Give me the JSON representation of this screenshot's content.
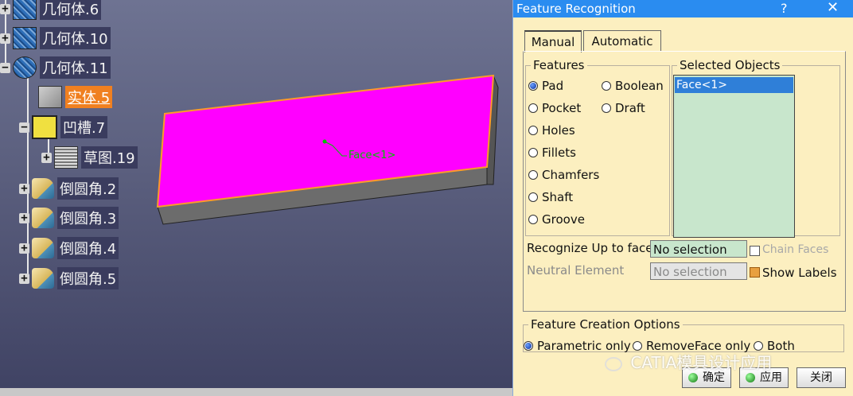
{
  "tree": {
    "nodes": [
      {
        "label": "几何体.6",
        "toggle": "+",
        "icon": "geometry-icon"
      },
      {
        "label": "几何体.10",
        "toggle": "+",
        "icon": "geometry-icon"
      },
      {
        "label": "几何体.11",
        "toggle": "−",
        "icon": "geometry-body-gear-icon"
      },
      {
        "label": "实体.5",
        "icon": "solid-icon",
        "selected": true
      },
      {
        "label": "凹槽.7",
        "toggle": "−",
        "icon": "pocket-icon"
      },
      {
        "label": "草图.19",
        "toggle": "+",
        "icon": "sketch-icon"
      },
      {
        "label": "倒圆角.2",
        "toggle": "+",
        "icon": "fillet-icon"
      },
      {
        "label": "倒圆角.3",
        "toggle": "+",
        "icon": "fillet-icon"
      },
      {
        "label": "倒圆角.4",
        "toggle": "+",
        "icon": "fillet-icon"
      },
      {
        "label": "倒圆角.5",
        "toggle": "+",
        "icon": "fillet-icon"
      }
    ]
  },
  "viewport": {
    "face_label": "Face<1>",
    "face_color": "#ff00ff",
    "edge_color": "#ff9a2a"
  },
  "dialog": {
    "title": "Feature Recognition",
    "help": "?",
    "close": "✕",
    "tabs": [
      {
        "label": "Manual",
        "active": true
      },
      {
        "label": "Automatic",
        "active": false
      }
    ],
    "features": {
      "legend": "Features",
      "options": [
        {
          "label": "Pad",
          "checked": true
        },
        {
          "label": "Boolean",
          "checked": false
        },
        {
          "label": "Pocket",
          "checked": false
        },
        {
          "label": "Draft",
          "checked": false
        },
        {
          "label": "Holes",
          "checked": false
        },
        {
          "label": "Fillets",
          "checked": false
        },
        {
          "label": "Chamfers",
          "checked": false
        },
        {
          "label": "Shaft",
          "checked": false
        },
        {
          "label": "Groove",
          "checked": false
        }
      ]
    },
    "selected_objects": {
      "legend": "Selected Objects",
      "items": [
        "Face<1>"
      ]
    },
    "recognize_up_to_face": {
      "label": "Recognize Up to face",
      "value": "No selection"
    },
    "neutral_element": {
      "label": "Neutral Element",
      "value": "No selection"
    },
    "chain_faces": {
      "label": "Chain Faces",
      "checked": false,
      "enabled": false
    },
    "show_labels": {
      "label": "Show Labels",
      "checked": true
    },
    "creation_options": {
      "legend": "Feature Creation Options",
      "options": [
        {
          "label": "Parametric only",
          "checked": true
        },
        {
          "label": "RemoveFace only",
          "checked": false
        },
        {
          "label": "Both",
          "checked": false
        }
      ]
    },
    "buttons": {
      "ok": "确定",
      "apply": "应用",
      "close": "关闭"
    },
    "watermark": "CATIA模具设计应用"
  }
}
